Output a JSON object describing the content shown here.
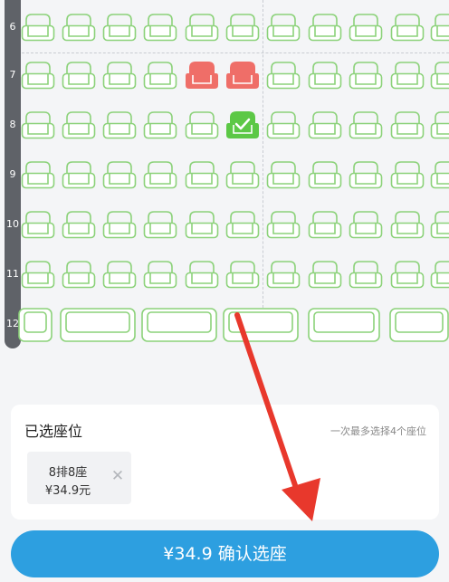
{
  "seat_map": {
    "rows": [
      "6",
      "7",
      "8",
      "9",
      "10",
      "11",
      "12"
    ],
    "colors": {
      "available": "#8cd27a",
      "sold": "#ef6e68",
      "selected": "#5cc846",
      "row_bar": "#5f6268"
    },
    "sold_seats": [
      {
        "row": "7",
        "seat_index": 4
      },
      {
        "row": "7",
        "seat_index": 5
      }
    ],
    "selected_seats": [
      {
        "row": "8",
        "seat_index": 5
      }
    ],
    "couple_row": "12"
  },
  "selected_panel": {
    "title": "已选座位",
    "hint": "一次最多选择4个座位",
    "tickets": [
      {
        "seat": "8排8座",
        "price": "¥34.9元",
        "remove_icon": "close-icon"
      }
    ]
  },
  "confirm": {
    "label": "¥34.9 确认选座",
    "color": "#2d9fe0"
  },
  "annotation": {
    "arrow_color": "#e8382c"
  }
}
